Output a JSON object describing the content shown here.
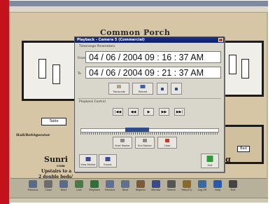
{
  "plan": {
    "porch_label": "Common Porch",
    "table_label": "Table",
    "hallway_label": "Hall/Refrigerator",
    "bed_label": "Bed",
    "footer_title": "Sunri",
    "footer_title_right": "g",
    "footer_sub1": "Upstairs to a",
    "footer_sub2": "2 double beds/",
    "footer_small": "com"
  },
  "dialog": {
    "title": "Playback - Camera 5 (Commercial)",
    "timerange_label": "Timerange Parameters",
    "from_label": "From",
    "to_label": "To",
    "from_value": "04 / 06 / 2004  09 : 16 : 37  AM",
    "to_value": "04 / 06 / 2004  09 : 21 : 37  AM",
    "buttons_row1": [
      "Transcode",
      "Reload",
      "",
      ""
    ],
    "playback_label": "Playback Control",
    "playback_buttons": [
      "|◀◀",
      "◀◀",
      "▶",
      "▶▶",
      "▶▶|"
    ],
    "marker_buttons": [
      "Start Marker",
      "End Marker",
      "Clear"
    ],
    "bottom_left_buttons": [
      "View Marker",
      "Export"
    ],
    "exit_label": "Exit"
  },
  "toolbar": {
    "items": [
      "Previous",
      "Close",
      "Next",
      "Live",
      "Playback",
      "Previous",
      "Next",
      "Register",
      "Monitor",
      "Search",
      "Help(F1)",
      "Log Off",
      "Help",
      "Exit"
    ]
  },
  "colors": {
    "accent": "#1c2e8a",
    "desktop_red": "#c3121b",
    "floor": "#d6c6a5"
  }
}
